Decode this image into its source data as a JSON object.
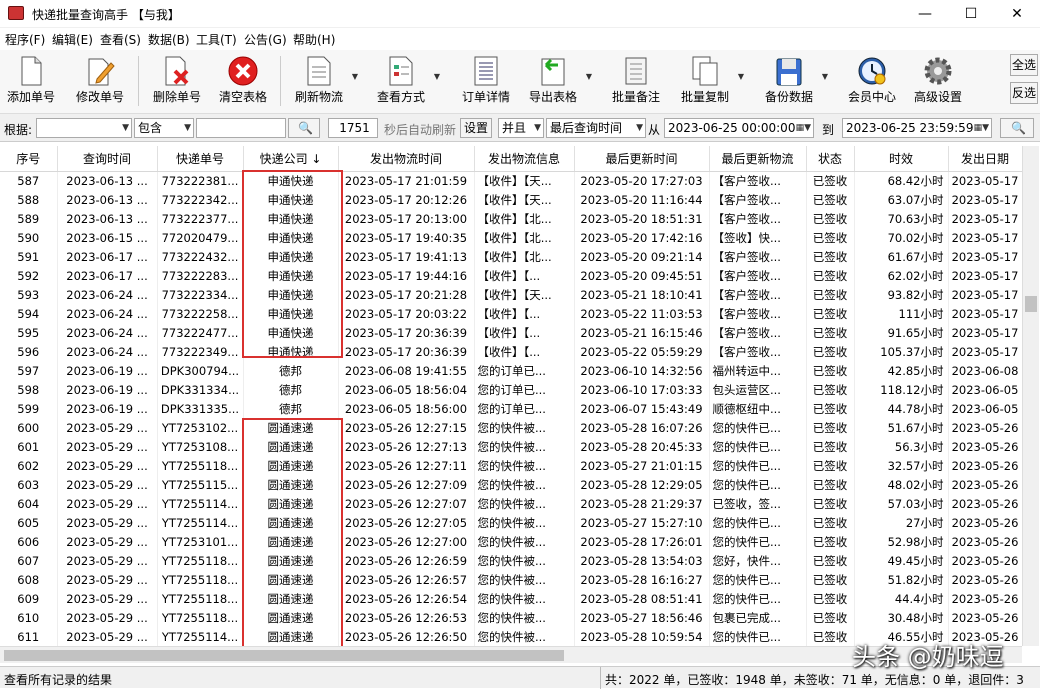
{
  "window": {
    "title": "快递批量查询高手 【与我】",
    "min": "—",
    "max": "☐",
    "close": "✕"
  },
  "menu": [
    "程序(F)",
    "编辑(E)",
    "查看(S)",
    "数据(B)",
    "工具(T)",
    "公告(G)",
    "帮助(H)"
  ],
  "toolbar": [
    {
      "label": "添加单号",
      "icon": "add-doc-icon",
      "dd": false
    },
    {
      "label": "修改单号",
      "icon": "pencil-doc-icon",
      "dd": false
    },
    {
      "label": "删除单号",
      "icon": "delete-doc-icon",
      "dd": false
    },
    {
      "label": "清空表格",
      "icon": "clear-table-icon",
      "dd": false
    },
    {
      "label": "刷新物流",
      "icon": "refresh-doc-icon",
      "dd": true
    },
    {
      "label": "查看方式",
      "icon": "view-mode-icon",
      "dd": true
    },
    {
      "label": "订单详情",
      "icon": "order-detail-icon",
      "dd": false
    },
    {
      "label": "导出表格",
      "icon": "export-table-icon",
      "dd": true
    },
    {
      "label": "批量备注",
      "icon": "batch-note-icon",
      "dd": false
    },
    {
      "label": "批量复制",
      "icon": "batch-copy-icon",
      "dd": true
    },
    {
      "label": "备份数据",
      "icon": "backup-icon",
      "dd": true
    },
    {
      "label": "会员中心",
      "icon": "member-clock-icon",
      "dd": false
    },
    {
      "label": "高级设置",
      "icon": "gear-icon",
      "dd": false
    }
  ],
  "side_buttons": {
    "select_all": "全选",
    "invert": "反选"
  },
  "filter": {
    "by_label": "根据:",
    "field_value": "",
    "match": "包含",
    "keyword": "",
    "search_icon": "🔍",
    "seconds": "1751",
    "auto_refresh_text": "秒后自动刷新",
    "settings": "设置",
    "logic": "并且",
    "time_field": "最后查询时间",
    "from_label": "从",
    "from_value": "2023-06-25 00:00:00",
    "to_label": "到",
    "to_value": "2023-06-25 23:59:59"
  },
  "columns": [
    "序号",
    "查询时间",
    "快递单号",
    "快递公司 ↓",
    "发出物流时间",
    "发出物流信息",
    "最后更新时间",
    "最后更新物流",
    "状态",
    "时效",
    "发出日期"
  ],
  "rows": [
    [
      "587",
      "2023-06-13 ...",
      "773222381...",
      "申通快递",
      "2023-05-17 21:01:59",
      "【收件】【天...",
      "2023-05-20 17:27:03",
      "【客户签收...",
      "已签收",
      "68.42小时",
      "2023-05-17"
    ],
    [
      "588",
      "2023-06-13 ...",
      "773222342...",
      "申通快递",
      "2023-05-17 20:12:26",
      "【收件】【天...",
      "2023-05-20 11:16:44",
      "【客户签收...",
      "已签收",
      "63.07小时",
      "2023-05-17"
    ],
    [
      "589",
      "2023-06-13 ...",
      "773222377...",
      "申通快递",
      "2023-05-17 20:13:00",
      "【收件】【北...",
      "2023-05-20 18:51:31",
      "【客户签收...",
      "已签收",
      "70.63小时",
      "2023-05-17"
    ],
    [
      "590",
      "2023-06-15 ...",
      "772020479...",
      "申通快递",
      "2023-05-17 19:40:35",
      "【收件】【北...",
      "2023-05-20 17:42:16",
      "【签收】快...",
      "已签收",
      "70.02小时",
      "2023-05-17"
    ],
    [
      "591",
      "2023-06-17 ...",
      "773222432...",
      "申通快递",
      "2023-05-17 19:41:13",
      "【收件】【北...",
      "2023-05-20 09:21:14",
      "【客户签收...",
      "已签收",
      "61.67小时",
      "2023-05-17"
    ],
    [
      "592",
      "2023-06-17 ...",
      "773222283...",
      "申通快递",
      "2023-05-17 19:44:16",
      "【收件】【...",
      "2023-05-20 09:45:51",
      "【客户签收...",
      "已签收",
      "62.02小时",
      "2023-05-17"
    ],
    [
      "593",
      "2023-06-24 ...",
      "773222334...",
      "申通快递",
      "2023-05-17 20:21:28",
      "【收件】【天...",
      "2023-05-21 18:10:41",
      "【客户签收...",
      "已签收",
      "93.82小时",
      "2023-05-17"
    ],
    [
      "594",
      "2023-06-24 ...",
      "773222258...",
      "申通快递",
      "2023-05-17 20:03:22",
      "【收件】【...",
      "2023-05-22 11:03:53",
      "【客户签收...",
      "已签收",
      "111小时",
      "2023-05-17"
    ],
    [
      "595",
      "2023-06-24 ...",
      "773222477...",
      "申通快递",
      "2023-05-17 20:36:39",
      "【收件】【...",
      "2023-05-21 16:15:46",
      "【客户签收...",
      "已签收",
      "91.65小时",
      "2023-05-17"
    ],
    [
      "596",
      "2023-06-24 ...",
      "773222349...",
      "申通快递",
      "2023-05-17 20:36:39",
      "【收件】【...",
      "2023-05-22 05:59:29",
      "【客户签收...",
      "已签收",
      "105.37小时",
      "2023-05-17"
    ],
    [
      "597",
      "2023-06-19 ...",
      "DPK300794...",
      "德邦",
      "2023-06-08 19:41:55",
      "您的订单已...",
      "2023-06-10 14:32:56",
      "福州转运中...",
      "已签收",
      "42.85小时",
      "2023-06-08"
    ],
    [
      "598",
      "2023-06-19 ...",
      "DPK331334...",
      "德邦",
      "2023-06-05 18:56:04",
      "您的订单已...",
      "2023-06-10 17:03:33",
      "包头运营区...",
      "已签收",
      "118.12小时",
      "2023-06-05"
    ],
    [
      "599",
      "2023-06-19 ...",
      "DPK331335...",
      "德邦",
      "2023-06-05 18:56:00",
      "您的订单已...",
      "2023-06-07 15:43:49",
      "顺德枢纽中...",
      "已签收",
      "44.78小时",
      "2023-06-05"
    ],
    [
      "600",
      "2023-05-29 ...",
      "YT7253102...",
      "圆通速递",
      "2023-05-26 12:27:15",
      "您的快件被...",
      "2023-05-28 16:07:26",
      "您的快件已...",
      "已签收",
      "51.67小时",
      "2023-05-26"
    ],
    [
      "601",
      "2023-05-29 ...",
      "YT7253108...",
      "圆通速递",
      "2023-05-26 12:27:13",
      "您的快件被...",
      "2023-05-28 20:45:33",
      "您的快件已...",
      "已签收",
      "56.3小时",
      "2023-05-26"
    ],
    [
      "602",
      "2023-05-29 ...",
      "YT7255118...",
      "圆通速递",
      "2023-05-26 12:27:11",
      "您的快件被...",
      "2023-05-27 21:01:15",
      "您的快件已...",
      "已签收",
      "32.57小时",
      "2023-05-26"
    ],
    [
      "603",
      "2023-05-29 ...",
      "YT7255115...",
      "圆通速递",
      "2023-05-26 12:27:09",
      "您的快件被...",
      "2023-05-28 12:29:05",
      "您的快件已...",
      "已签收",
      "48.02小时",
      "2023-05-26"
    ],
    [
      "604",
      "2023-05-29 ...",
      "YT7255114...",
      "圆通速递",
      "2023-05-26 12:27:07",
      "您的快件被...",
      "2023-05-28 21:29:37",
      "已签收，签...",
      "已签收",
      "57.03小时",
      "2023-05-26"
    ],
    [
      "605",
      "2023-05-29 ...",
      "YT7255114...",
      "圆通速递",
      "2023-05-26 12:27:05",
      "您的快件被...",
      "2023-05-27 15:27:10",
      "您的快件已...",
      "已签收",
      "27小时",
      "2023-05-26"
    ],
    [
      "606",
      "2023-05-29 ...",
      "YT7253101...",
      "圆通速递",
      "2023-05-26 12:27:00",
      "您的快件被...",
      "2023-05-28 17:26:01",
      "您的快件已...",
      "已签收",
      "52.98小时",
      "2023-05-26"
    ],
    [
      "607",
      "2023-05-29 ...",
      "YT7255118...",
      "圆通速递",
      "2023-05-26 12:26:59",
      "您的快件被...",
      "2023-05-28 13:54:03",
      "您好，快件...",
      "已签收",
      "49.45小时",
      "2023-05-26"
    ],
    [
      "608",
      "2023-05-29 ...",
      "YT7255118...",
      "圆通速递",
      "2023-05-26 12:26:57",
      "您的快件被...",
      "2023-05-28 16:16:27",
      "您的快件已...",
      "已签收",
      "51.82小时",
      "2023-05-26"
    ],
    [
      "609",
      "2023-05-29 ...",
      "YT7255118...",
      "圆通速递",
      "2023-05-26 12:26:54",
      "您的快件被...",
      "2023-05-28 08:51:41",
      "您的快件已...",
      "已签收",
      "44.4小时",
      "2023-05-26"
    ],
    [
      "610",
      "2023-05-29 ...",
      "YT7255118...",
      "圆通速递",
      "2023-05-26 12:26:53",
      "您的快件被...",
      "2023-05-27 18:56:46",
      "包裹已完成...",
      "已签收",
      "30.48小时",
      "2023-05-26"
    ],
    [
      "611",
      "2023-05-29 ...",
      "YT7255114...",
      "圆通速递",
      "2023-05-26 12:26:50",
      "您的快件被...",
      "2023-05-28 10:59:54",
      "您的快件已...",
      "已签收",
      "46.55小时",
      "2023-05-26"
    ]
  ],
  "status": {
    "left": "查看所有记录的结果",
    "right": "共：2022 单，已签收：1948 单，未签收：71 单，无信息：0 单，退回件：3"
  },
  "watermark": "头条 @奶味逗",
  "colors": {
    "highlight": "#d9312f"
  }
}
